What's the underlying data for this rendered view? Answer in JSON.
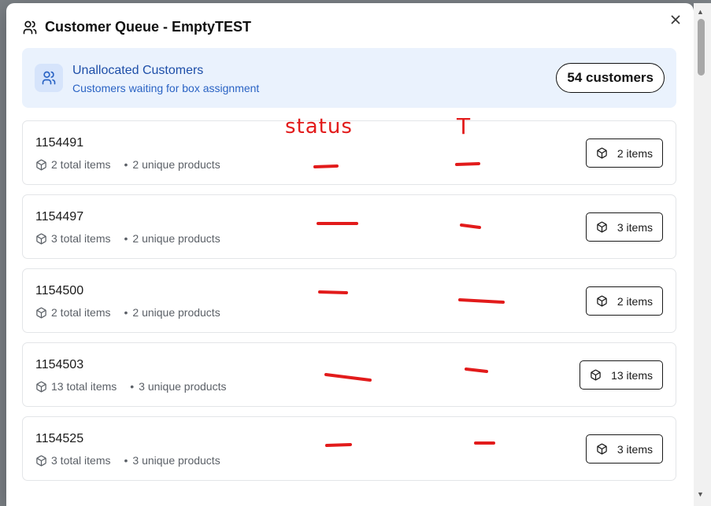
{
  "header": {
    "title": "Customer Queue - EmptyTEST"
  },
  "banner": {
    "title": "Unallocated Customers",
    "subtitle": "Customers waiting for box assignment",
    "count": "54 customers"
  },
  "annotations": {
    "status": "status",
    "t": "T"
  },
  "customers": [
    {
      "id": "1154491",
      "total": "2 total items",
      "unique": "2 unique products",
      "badge": "2 items"
    },
    {
      "id": "1154497",
      "total": "3 total items",
      "unique": "2 unique products",
      "badge": "3 items"
    },
    {
      "id": "1154500",
      "total": "2 total items",
      "unique": "2 unique products",
      "badge": "2 items"
    },
    {
      "id": "1154503",
      "total": "13 total items",
      "unique": "3 unique products",
      "badge": "13 items"
    },
    {
      "id": "1154525",
      "total": "3 total items",
      "unique": "3 unique products",
      "badge": "3 items"
    }
  ],
  "colors": {
    "accent": "#1d4ea8",
    "banner_bg": "#eaf2fd",
    "annotation": "#e21b1b"
  }
}
